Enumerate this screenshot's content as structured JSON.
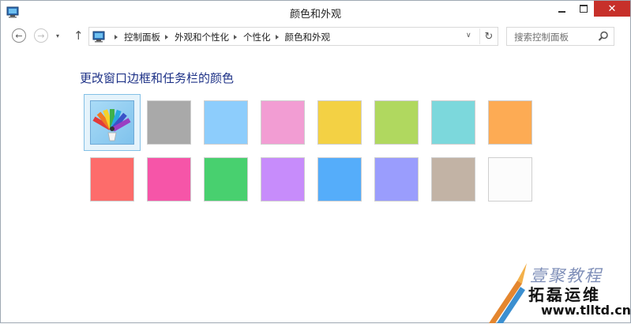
{
  "window": {
    "title": "颜色和外观",
    "icon": "control-panel-icon",
    "close_glyph": "✕"
  },
  "nav": {
    "back_glyph": "←",
    "forward_glyph": "→",
    "recent_glyph": "▾",
    "up_glyph": "↑",
    "breadcrumbs": [
      "控制面板",
      "外观和个性化",
      "个性化",
      "颜色和外观"
    ],
    "dropdown_glyph": "∨",
    "refresh_glyph": "↻"
  },
  "search": {
    "placeholder": "搜索控制面板"
  },
  "content": {
    "heading": "更改窗口边框和任务栏的颜色",
    "selected_index": 0,
    "swatches": [
      {
        "name": "automatic-color",
        "color": "auto"
      },
      {
        "name": "gray",
        "color": "#a9a9a9"
      },
      {
        "name": "light-blue",
        "color": "#8dcdfc"
      },
      {
        "name": "pink",
        "color": "#f29dd3"
      },
      {
        "name": "yellow",
        "color": "#f3d144"
      },
      {
        "name": "green",
        "color": "#b0d85f"
      },
      {
        "name": "teal",
        "color": "#7cd8dc"
      },
      {
        "name": "orange",
        "color": "#fdab54"
      },
      {
        "name": "red",
        "color": "#fd6c6b"
      },
      {
        "name": "magenta",
        "color": "#f655a8"
      },
      {
        "name": "emerald",
        "color": "#48d06f"
      },
      {
        "name": "violet",
        "color": "#c78cfb"
      },
      {
        "name": "blue",
        "color": "#55adfa"
      },
      {
        "name": "periwinkle",
        "color": "#9a9dfd"
      },
      {
        "name": "taupe",
        "color": "#c2b3a5"
      },
      {
        "name": "white",
        "color": "#fcfcfc"
      }
    ]
  },
  "watermark": {
    "line1": "壹聚教程",
    "line2": "拓磊运维",
    "url": "www.tlltd.cn"
  }
}
